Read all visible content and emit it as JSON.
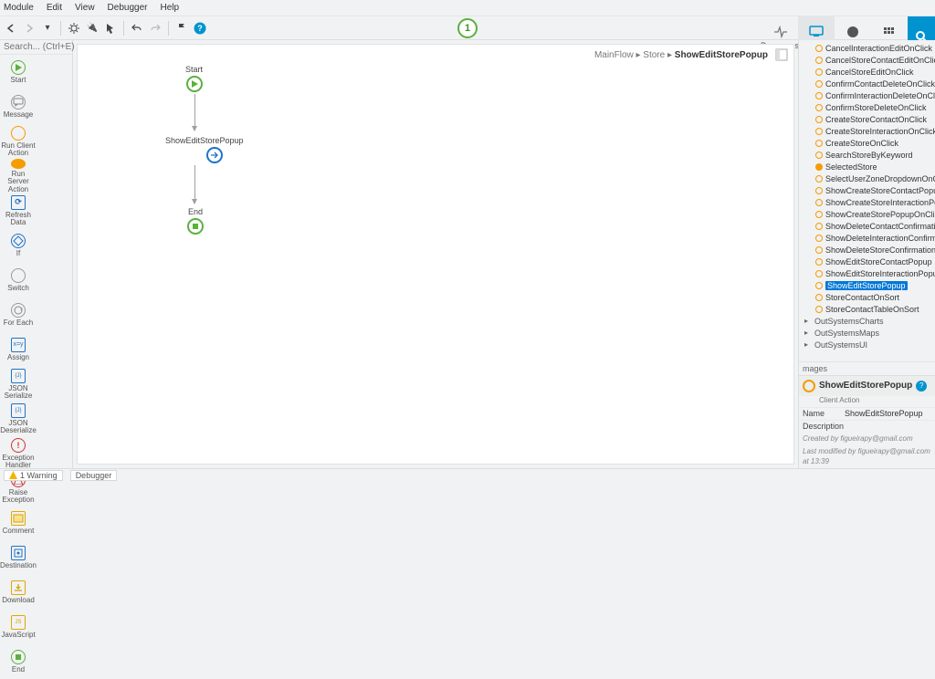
{
  "menubar": [
    "Module",
    "Edit",
    "View",
    "Debugger",
    "Help"
  ],
  "center_badge": "1",
  "right_tabs": [
    {
      "label": "Processes"
    },
    {
      "label": "Interface"
    },
    {
      "label": "Logic"
    },
    {
      "label": "Data"
    }
  ],
  "search_placeholder": "Search... (Ctrl+E)",
  "widgets": [
    {
      "label": "Start",
      "ring": "#5ab13d",
      "inner": "play"
    },
    {
      "label": "Message",
      "ring": "#999",
      "inner": "msg"
    },
    {
      "label": "Run Client\nAction",
      "ring": "#f59c00",
      "inner": ""
    },
    {
      "label": "Run Server\nAction",
      "ring": "#f59c00",
      "fill": "#f59c00",
      "inner": ""
    },
    {
      "label": "Refresh\nData",
      "ring": "#1e73c7",
      "inner": "ref",
      "square": true
    },
    {
      "label": "If",
      "ring": "#1e73c7",
      "inner": "if"
    },
    {
      "label": "Switch",
      "ring": "#999",
      "inner": ""
    },
    {
      "label": "For Each",
      "ring": "#999",
      "inner": "fe"
    },
    {
      "label": "Assign",
      "ring": "#1e73c7",
      "inner": "as",
      "square": true
    },
    {
      "label": "JSON\nSerialize",
      "ring": "#1e73c7",
      "inner": "js",
      "square": true
    },
    {
      "label": "JSON\nDeserialize",
      "ring": "#1e73c7",
      "inner": "jd",
      "square": true
    },
    {
      "label": "Exception\nHandler",
      "ring": "#c33",
      "inner": "!"
    },
    {
      "label": "Raise\nException",
      "ring": "#c33",
      "inner": "ex"
    },
    {
      "label": "Comment",
      "ring": "#e0a800",
      "inner": "cm",
      "square": true
    },
    {
      "label": "Destination",
      "ring": "#1e73c7",
      "inner": "dest",
      "square": true
    },
    {
      "label": "Download",
      "ring": "#e0a800",
      "inner": "dl",
      "square": true
    },
    {
      "label": "JavaScript",
      "ring": "#e0a800",
      "inner": "jsx",
      "square": true
    },
    {
      "label": "End",
      "ring": "#5ab13d",
      "inner": "end"
    }
  ],
  "breadcrumb": {
    "path": "MainFlow ▸ Store ▸ ",
    "current": "ShowEditStorePopup"
  },
  "flow": {
    "start": {
      "label": "Start"
    },
    "action": {
      "label": "ShowEditStorePopup"
    },
    "end": {
      "label": "End"
    }
  },
  "tree_items": [
    {
      "label": "CancelInteractionEditOnClick"
    },
    {
      "label": "CancelStoreContactEditOnClick"
    },
    {
      "label": "CancelStoreEditOnClick"
    },
    {
      "label": "ConfirmContactDeleteOnClick"
    },
    {
      "label": "ConfirmInteractionDeleteOnClick"
    },
    {
      "label": "ConfirmStoreDeleteOnClick"
    },
    {
      "label": "CreateStoreContactOnClick"
    },
    {
      "label": "CreateStoreInteractionOnClick"
    },
    {
      "label": "CreateStoreOnClick"
    },
    {
      "label": "SearchStoreByKeyword"
    },
    {
      "label": "SelectedStore",
      "fill": true
    },
    {
      "label": "SelectUserZoneDropdownOnChange"
    },
    {
      "label": "ShowCreateStoreContactPopupOnClick"
    },
    {
      "label": "ShowCreateStoreInteractionPopupOnClick"
    },
    {
      "label": "ShowCreateStorePopupOnClick"
    },
    {
      "label": "ShowDeleteContactConfirmationPopup"
    },
    {
      "label": "ShowDeleteInteractionConfirmationPopup"
    },
    {
      "label": "ShowDeleteStoreConfirmationPopupOnClick"
    },
    {
      "label": "ShowEditStoreContactPopup"
    },
    {
      "label": "ShowEditStoreInteractionPopup"
    },
    {
      "label": "ShowEditStorePopup",
      "selected": true
    },
    {
      "label": "StoreContactOnSort"
    },
    {
      "label": "StoreContactTableOnSort"
    }
  ],
  "tree_groups": [
    "OutSystemsCharts",
    "OutSystemsMaps",
    "OutSystemsUI"
  ],
  "tree_footer": "mages",
  "props": {
    "title": "ShowEditStorePopup",
    "subtitle": "Client Action",
    "rows": [
      {
        "k": "Name",
        "v": "ShowEditStorePopup"
      },
      {
        "k": "Description",
        "v": ""
      }
    ],
    "meta1": "Created by figueirapy@gmail.com",
    "meta2": "Last modified by figueirapy@gmail.com at 13:39"
  },
  "status": {
    "warnings": "1 Warning",
    "debugger": "Debugger"
  }
}
